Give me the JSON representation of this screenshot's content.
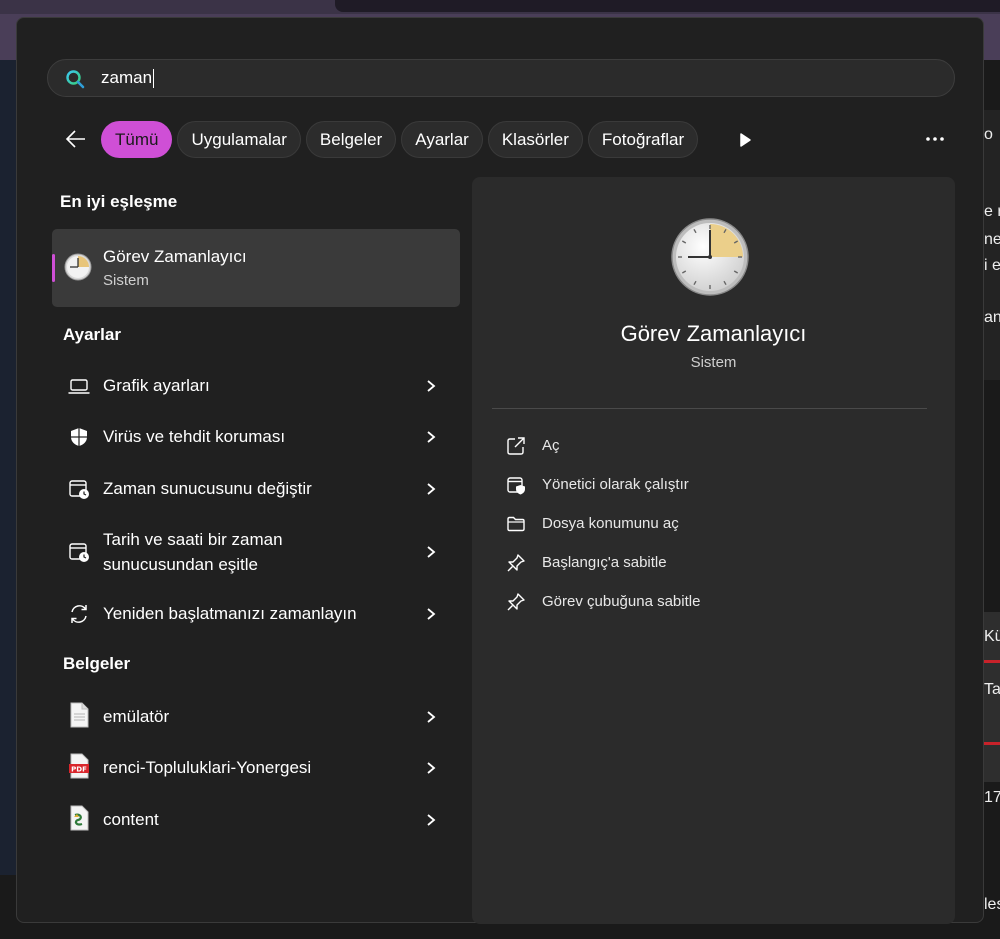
{
  "search": {
    "value": "zaman",
    "placeholder": ""
  },
  "filters": {
    "tabs": [
      "Tümü",
      "Uygulamalar",
      "Belgeler",
      "Ayarlar",
      "Klasörler",
      "Fotoğraflar"
    ],
    "active": "Tümü",
    "accent": "#cf4fd6"
  },
  "best_match": {
    "heading": "En iyi eşleşme",
    "title": "Görev Zamanlayıcı",
    "subtitle": "Sistem",
    "icon": "clock-icon"
  },
  "settings": {
    "heading": "Ayarlar",
    "items": [
      {
        "label": "Grafik ayarları",
        "icon": "laptop-icon"
      },
      {
        "label": "Virüs ve tehdit koruması",
        "icon": "shield-icon"
      },
      {
        "label": "Zaman sunucusunu değiştir",
        "icon": "calendar-clock-icon"
      },
      {
        "label_line1": "Tarih ve saati bir zaman",
        "label_line2": "sunucusundan eşitle",
        "icon": "calendar-clock-icon"
      },
      {
        "label": "Yeniden başlatmanızı zamanlayın",
        "icon": "restart-icon"
      }
    ]
  },
  "documents": {
    "heading": "Belgeler",
    "items": [
      {
        "label": "emülatör",
        "icon": "document-icon"
      },
      {
        "label": "renci-Topluluklari-Yonergesi",
        "icon": "pdf-icon"
      },
      {
        "label": "content",
        "icon": "script-file-icon"
      }
    ]
  },
  "detail": {
    "title": "Görev Zamanlayıcı",
    "subtitle": "Sistem",
    "actions": [
      {
        "label": "Aç",
        "icon": "open-external-icon"
      },
      {
        "label": "Yönetici olarak çalıştır",
        "icon": "run-as-admin-icon"
      },
      {
        "label": "Dosya konumunu aç",
        "icon": "folder-icon"
      },
      {
        "label": "Başlangıç'a sabitle",
        "icon": "pin-icon"
      },
      {
        "label": "Görev çubuğuna sabitle",
        "icon": "pin-icon"
      }
    ]
  },
  "background": {
    "right_texts": [
      "o",
      "e r",
      "nes",
      "i e",
      "an",
      "Kü",
      "Ta",
      "17",
      "les"
    ]
  }
}
